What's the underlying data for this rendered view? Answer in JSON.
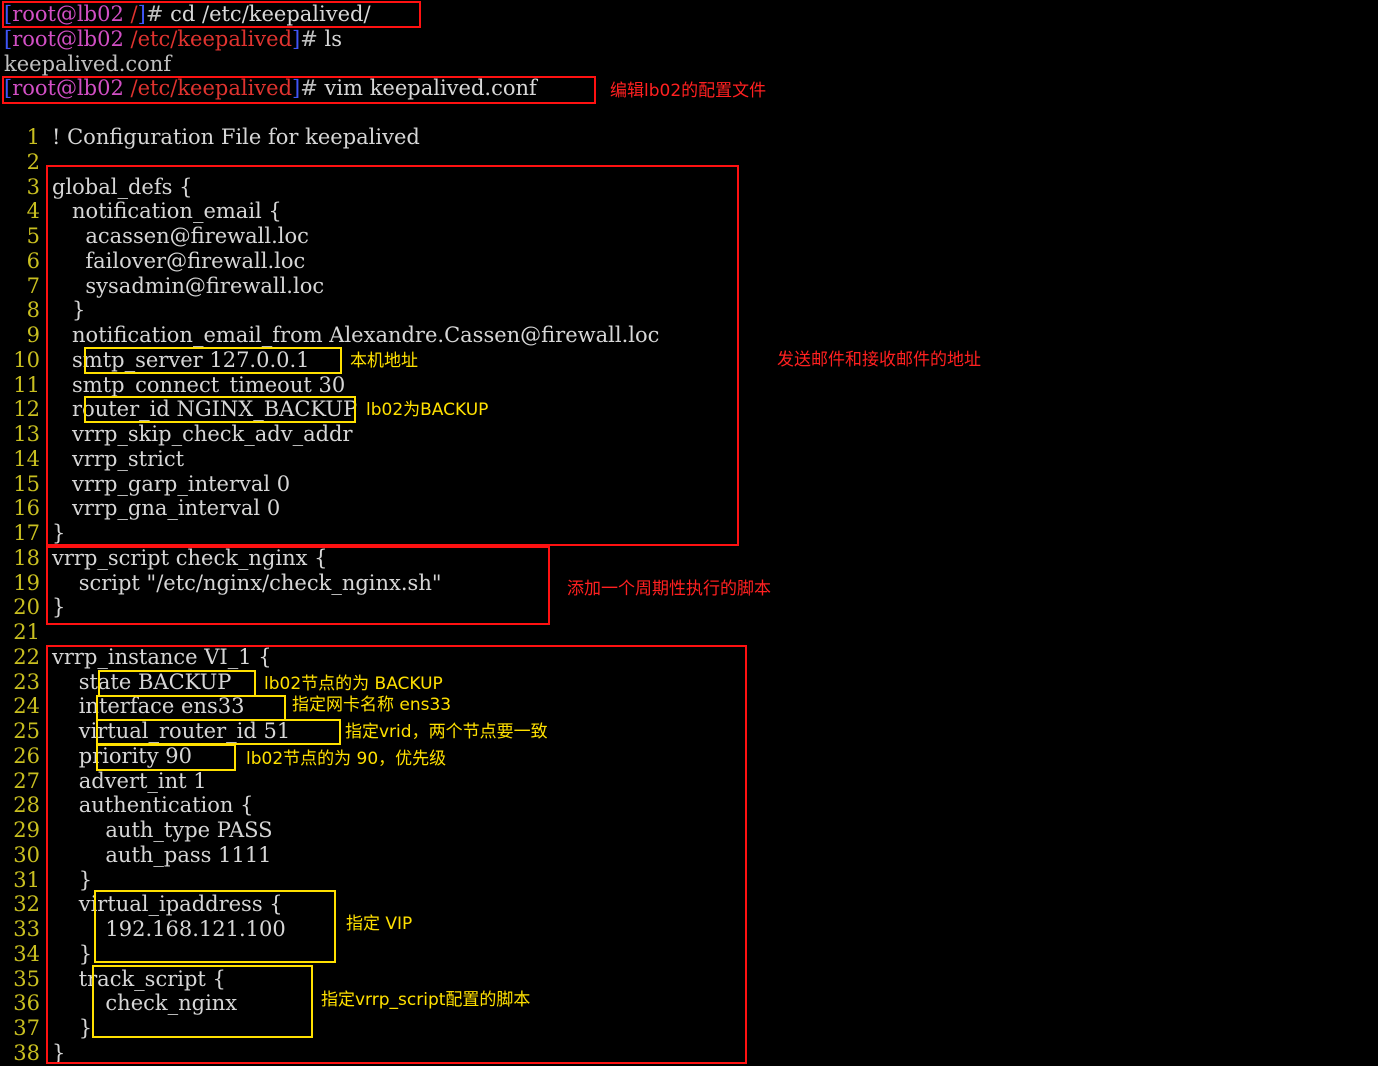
{
  "terminal": {
    "commands": [
      {
        "user": "root@lb02",
        "path": "/",
        "cmd": "cd /etc/keepalived/"
      },
      {
        "user": "root@lb02",
        "path": "/etc/keepalived",
        "cmd": "ls"
      },
      {
        "output": "keepalived.conf"
      },
      {
        "user": "root@lb02",
        "path": "/etc/keepalived",
        "cmd": "vim keepalived.conf"
      }
    ]
  },
  "editor": {
    "lines": [
      {
        "n": "1",
        "text": "! Configuration File for keepalived"
      },
      {
        "n": "2",
        "text": ""
      },
      {
        "n": "3",
        "text": "global_defs {"
      },
      {
        "n": "4",
        "text": "   notification_email {"
      },
      {
        "n": "5",
        "text": "     acassen@firewall.loc"
      },
      {
        "n": "6",
        "text": "     failover@firewall.loc"
      },
      {
        "n": "7",
        "text": "     sysadmin@firewall.loc"
      },
      {
        "n": "8",
        "text": "   }"
      },
      {
        "n": "9",
        "text": "   notification_email_from Alexandre.Cassen@firewall.loc"
      },
      {
        "n": "10",
        "text": "   smtp_server 127.0.0.1"
      },
      {
        "n": "11",
        "text": "   smtp_connect_timeout 30"
      },
      {
        "n": "12",
        "text": "   router_id NGINX_BACKUP"
      },
      {
        "n": "13",
        "text": "   vrrp_skip_check_adv_addr"
      },
      {
        "n": "14",
        "text": "   vrrp_strict"
      },
      {
        "n": "15",
        "text": "   vrrp_garp_interval 0"
      },
      {
        "n": "16",
        "text": "   vrrp_gna_interval 0"
      },
      {
        "n": "17",
        "text": "}"
      },
      {
        "n": "18",
        "text": "vrrp_script check_nginx {"
      },
      {
        "n": "19",
        "text": "    script \"/etc/nginx/check_nginx.sh\""
      },
      {
        "n": "20",
        "text": "}"
      },
      {
        "n": "21",
        "text": ""
      },
      {
        "n": "22",
        "text": "vrrp_instance VI_1 {"
      },
      {
        "n": "23",
        "text": "    state BACKUP"
      },
      {
        "n": "24",
        "text": "    interface ens33"
      },
      {
        "n": "25",
        "text": "    virtual_router_id 51"
      },
      {
        "n": "26",
        "text": "    priority 90"
      },
      {
        "n": "27",
        "text": "    advert_int 1"
      },
      {
        "n": "28",
        "text": "    authentication {"
      },
      {
        "n": "29",
        "text": "        auth_type PASS"
      },
      {
        "n": "30",
        "text": "        auth_pass 1111"
      },
      {
        "n": "31",
        "text": "    }"
      },
      {
        "n": "32",
        "text": "    virtual_ipaddress {"
      },
      {
        "n": "33",
        "text": "        192.168.121.100"
      },
      {
        "n": "34",
        "text": "    }"
      },
      {
        "n": "35",
        "text": "    track_script {"
      },
      {
        "n": "36",
        "text": "        check_nginx"
      },
      {
        "n": "37",
        "text": "    }"
      },
      {
        "n": "38",
        "text": "}"
      }
    ]
  },
  "annotations": {
    "edit_config": "编辑lb02的配置文件",
    "mail_address": "发送邮件和接收邮件的地址",
    "local_address": "本机地址",
    "router_id": "lb02为BACKUP",
    "add_script": "添加一个周期性执行的脚本",
    "state_backup": "lb02节点的为 BACKUP",
    "nic_name": "指定网卡名称 ens33",
    "vrid": "指定vrid，两个节点要一致",
    "priority": "lb02节点的为 90，优先级",
    "vip": "指定 VIP",
    "track_script": "指定vrrp_script配置的脚本"
  },
  "colors": {
    "background": "#000000",
    "line_numbers": "#c9bf20",
    "prompt_bracket": "#3f55f7",
    "prompt_user": "#d24fc5",
    "prompt_path": "#e0332f",
    "annotation_red": "#ff2020",
    "annotation_yellow": "#ffe000"
  }
}
